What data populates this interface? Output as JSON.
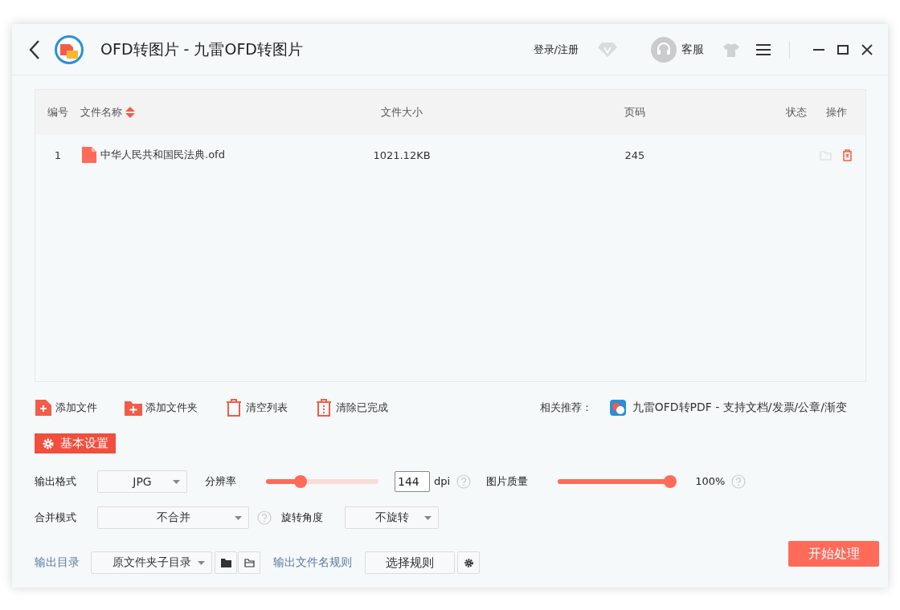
{
  "window": {
    "title": "OFD转图片 - 九雷OFD转图片"
  },
  "header": {
    "login": "登录/注册",
    "service": "客服"
  },
  "table": {
    "columns": [
      {
        "label": "编号",
        "sorted": false
      },
      {
        "label": "文件名称",
        "sorted": true
      },
      {
        "label": "文件大小",
        "sorted": false
      },
      {
        "label": "页码",
        "sorted": false
      },
      {
        "label": "状态",
        "sorted": false
      },
      {
        "label": "操作",
        "sorted": false
      }
    ],
    "rows": [
      {
        "index": "1",
        "name": "中华人民共和国民法典.ofd",
        "size": "1021.12KB",
        "pages": "245"
      }
    ]
  },
  "actions": [
    {
      "label": "添加文件",
      "kind": "add-file"
    },
    {
      "label": "添加文件夹",
      "kind": "add-folder"
    },
    {
      "label": "清空列表",
      "kind": "clear"
    },
    {
      "label": "清除已完成",
      "kind": "clear-done"
    }
  ],
  "recommend": {
    "label": "相关推荐：",
    "link": "九雷OFD转PDF - 支持文档/发票/公章/渐变"
  },
  "settings_tab": {
    "label": "基本设置",
    "selected": true
  },
  "settings": {
    "format": {
      "label": "输出格式",
      "value": "JPG"
    },
    "resolution": {
      "label": "分辨率",
      "level": 0.31,
      "value": "144",
      "unit": "dpi"
    },
    "quality": {
      "label": "图片质量",
      "level": 1,
      "reading": "100%"
    },
    "merge": {
      "label": "合并模式",
      "value": "不合并"
    },
    "rotate": {
      "label": "旋转角度",
      "value": "不旋转"
    }
  },
  "output": {
    "dir_label": "输出目录",
    "dir_value": "原文件夹子目录",
    "rule_label": "输出文件名规则",
    "rule_button": "选择规则"
  },
  "start_button": "开始处理"
}
